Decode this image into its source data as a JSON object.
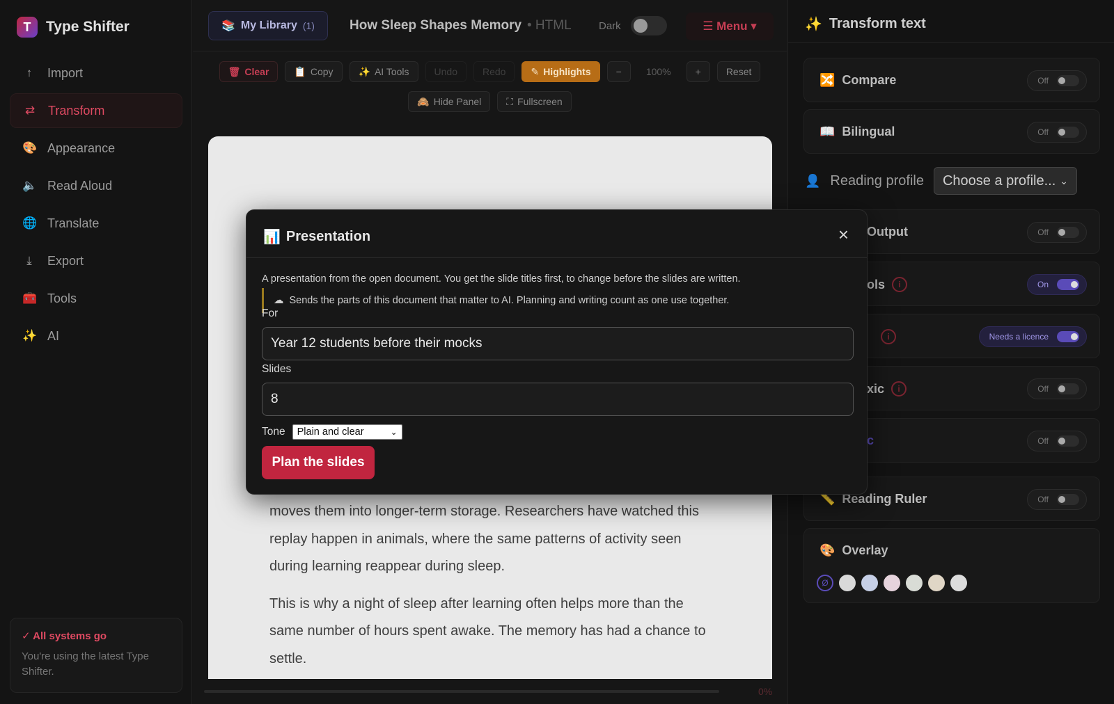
{
  "brand": {
    "name": "Type Shifter"
  },
  "sidebar": {
    "items": [
      {
        "label": "Import",
        "icon": "upload-icon"
      },
      {
        "label": "Transform",
        "icon": "swap-icon"
      },
      {
        "label": "Appearance",
        "icon": "palette-icon"
      },
      {
        "label": "Read Aloud",
        "icon": "speaker-icon"
      },
      {
        "label": "Translate",
        "icon": "globe-icon"
      },
      {
        "label": "Export",
        "icon": "download-icon"
      },
      {
        "label": "Tools",
        "icon": "toolbox-icon"
      },
      {
        "label": "AI",
        "icon": "sparkle-icon"
      }
    ],
    "active": "Transform",
    "status": {
      "title": "✓ All systems go",
      "text": "You're using the latest Type Shifter."
    }
  },
  "header": {
    "library_label": "My Library",
    "library_count": "(1)",
    "doc_title": "How Sleep Shapes Memory",
    "doc_format": "• HTML",
    "dark_label": "Dark",
    "dark_on": false,
    "menu_label": "☰ Menu ▾"
  },
  "toolbar": {
    "clear": "Clear",
    "copy": "Copy",
    "ai_tools": "AI Tools",
    "undo": "Undo",
    "redo": "Redo",
    "highlights": "Highlights",
    "zoom_out": "−",
    "zoom": "100%",
    "zoom_in": "+",
    "reset": "Reset",
    "hide_panel": "Hide Panel",
    "fullscreen": "Fullscreen"
  },
  "document": {
    "paragraphs": [
      "moves them into longer-term storage. Researchers have watched this replay happen in animals, where the same patterns of activity seen during learning reappear during sleep.",
      "This is why a night of sleep after learning often helps more than the same number of hours spent awake. The memory has had a chance to settle."
    ],
    "progress_label": "0%",
    "progress": 0
  },
  "right_panel": {
    "title": "Transform text",
    "compare": {
      "label": "Compare",
      "state": "Off"
    },
    "bilingual": {
      "label": "Bilingual",
      "state": "Off"
    },
    "profile_label": "Reading profile",
    "profile_value": "Choose a profile...",
    "rows": [
      {
        "label": "Output",
        "state": "Off",
        "info": false
      },
      {
        "label": "ols",
        "state": "On",
        "info": true
      },
      {
        "label": "",
        "state": "Needs a licence",
        "info": true
      },
      {
        "label": "xic",
        "state": "Off",
        "info": true
      },
      {
        "label": "c",
        "state": "Off",
        "info": false
      },
      {
        "label": "Reading Ruler",
        "state": "Off",
        "info": false
      }
    ],
    "overlay": {
      "label": "Overlay",
      "none_symbol": "Ø",
      "swatches": [
        "#d9d9d9",
        "#c6cfe6",
        "#e6d3dc",
        "#d9dcd6",
        "#e0d6c6",
        "#dcdcdc"
      ]
    }
  },
  "modal": {
    "title": "Presentation",
    "description": "A presentation from the open document. You get the slide titles first, to change before the slides are written.",
    "note": "Sends the parts of this document that matter to AI. Planning and writing count as one use together.",
    "for_label": "For",
    "for_value": "Year 12 students before their mocks",
    "slides_label": "Slides",
    "slides_value": "8",
    "tone_label": "Tone",
    "tone_value": "Plain and clear",
    "submit": "Plan the slides",
    "close": "×"
  },
  "colors": {
    "accent": "#c1253f",
    "highlight": "#b76d16",
    "toggle_on": "#5a4bb8"
  }
}
